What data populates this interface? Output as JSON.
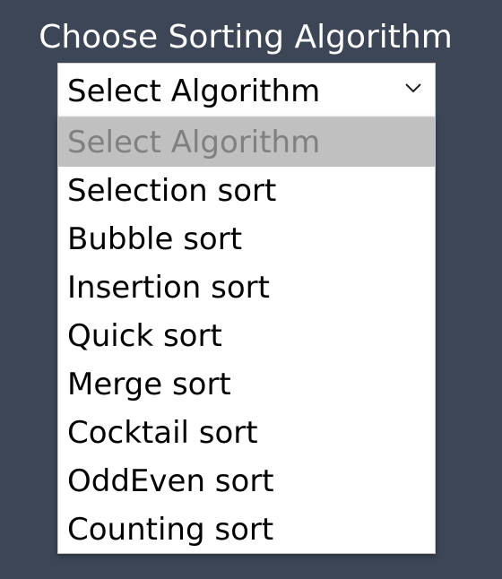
{
  "heading": "Choose Sorting Algorithm",
  "select": {
    "value": "Select Algorithm",
    "icon": "chevron-down-icon"
  },
  "options": [
    "Select Algorithm",
    "Selection sort",
    "Bubble sort",
    "Insertion sort",
    "Quick sort",
    "Merge sort",
    "Cocktail sort",
    "OddEven sort",
    "Counting sort"
  ],
  "colors": {
    "background": "#3c4657",
    "highlighted_option": "#c0c0c0",
    "disabled_text": "#808080"
  }
}
